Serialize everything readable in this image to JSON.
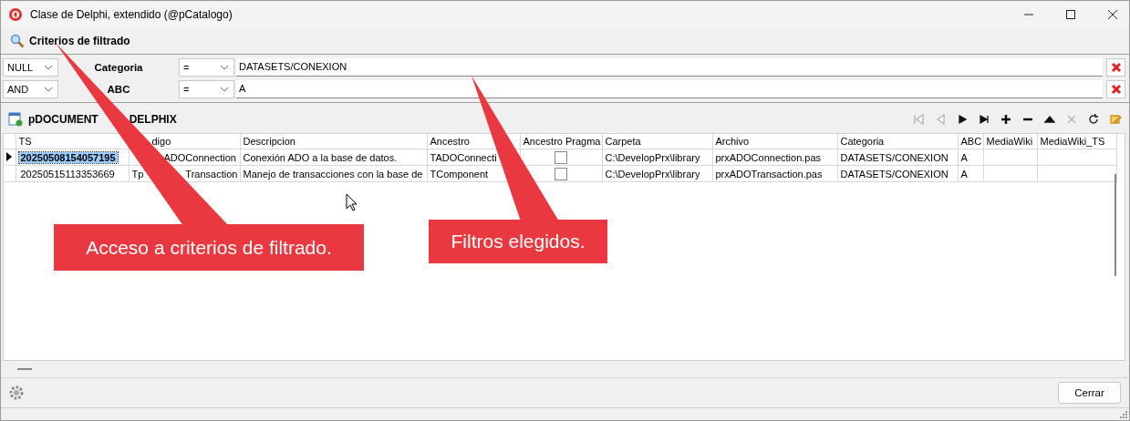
{
  "window": {
    "title": "Clase de Delphi, extendido (@pCatalogo)"
  },
  "filter_header": {
    "label": "Criterios de filtrado"
  },
  "filters": [
    {
      "connector": "NULL",
      "field": "Categoria",
      "operator": "=",
      "value": "DATASETS/CONEXION"
    },
    {
      "connector": "AND",
      "field": "ABC",
      "operator": "=",
      "value": "A"
    }
  ],
  "dataset": {
    "title_parts": [
      "pDOCUMENT",
      "DELPHIX"
    ]
  },
  "nav_buttons": [
    {
      "kind": "first",
      "disabled": true
    },
    {
      "kind": "prior",
      "disabled": true
    },
    {
      "kind": "next",
      "disabled": false
    },
    {
      "kind": "last",
      "disabled": false
    },
    {
      "kind": "insert",
      "disabled": false
    },
    {
      "kind": "delete",
      "disabled": false
    },
    {
      "kind": "edit",
      "disabled": false
    },
    {
      "kind": "cancel",
      "disabled": true
    },
    {
      "kind": "refresh",
      "disabled": false
    },
    {
      "kind": "post",
      "disabled": false
    }
  ],
  "table": {
    "columns": [
      "TS",
      "digo",
      "Descripcion",
      "Ancestro",
      "Ancestro Pragma",
      "Carpeta",
      "Archivo",
      "Categoria",
      "ABC",
      "MediaWiki",
      "MediaWiki_TS"
    ],
    "rows": [
      {
        "selected": true,
        "ts": "20250508154057195",
        "codigo": [
          "ADOConnection"
        ],
        "descripcion": "Conexión ADO a la base de datos.",
        "ancestro": "TADOConnecti",
        "pragma_checked": false,
        "carpeta": "C:\\DevelopPrx\\library",
        "archivo": "prxADOConnection.pas",
        "categoria": "DATASETS/CONEXION",
        "abc": "A"
      },
      {
        "selected": false,
        "ts": "20250515113353669",
        "codigo": [
          "Tp",
          "Transaction"
        ],
        "descripcion": "Manejo de transacciones con la base de",
        "ancestro": "TComponent",
        "pragma_checked": false,
        "carpeta": "C:\\DevelopPrx\\library",
        "archivo": "prxADOTransaction.pas",
        "categoria": "DATASETS/CONEXION",
        "abc": "A"
      }
    ]
  },
  "close_button": {
    "label": "Cerrar"
  },
  "callouts": [
    "Acceso a criterios de filtrado.",
    "Filtros elegidos."
  ]
}
